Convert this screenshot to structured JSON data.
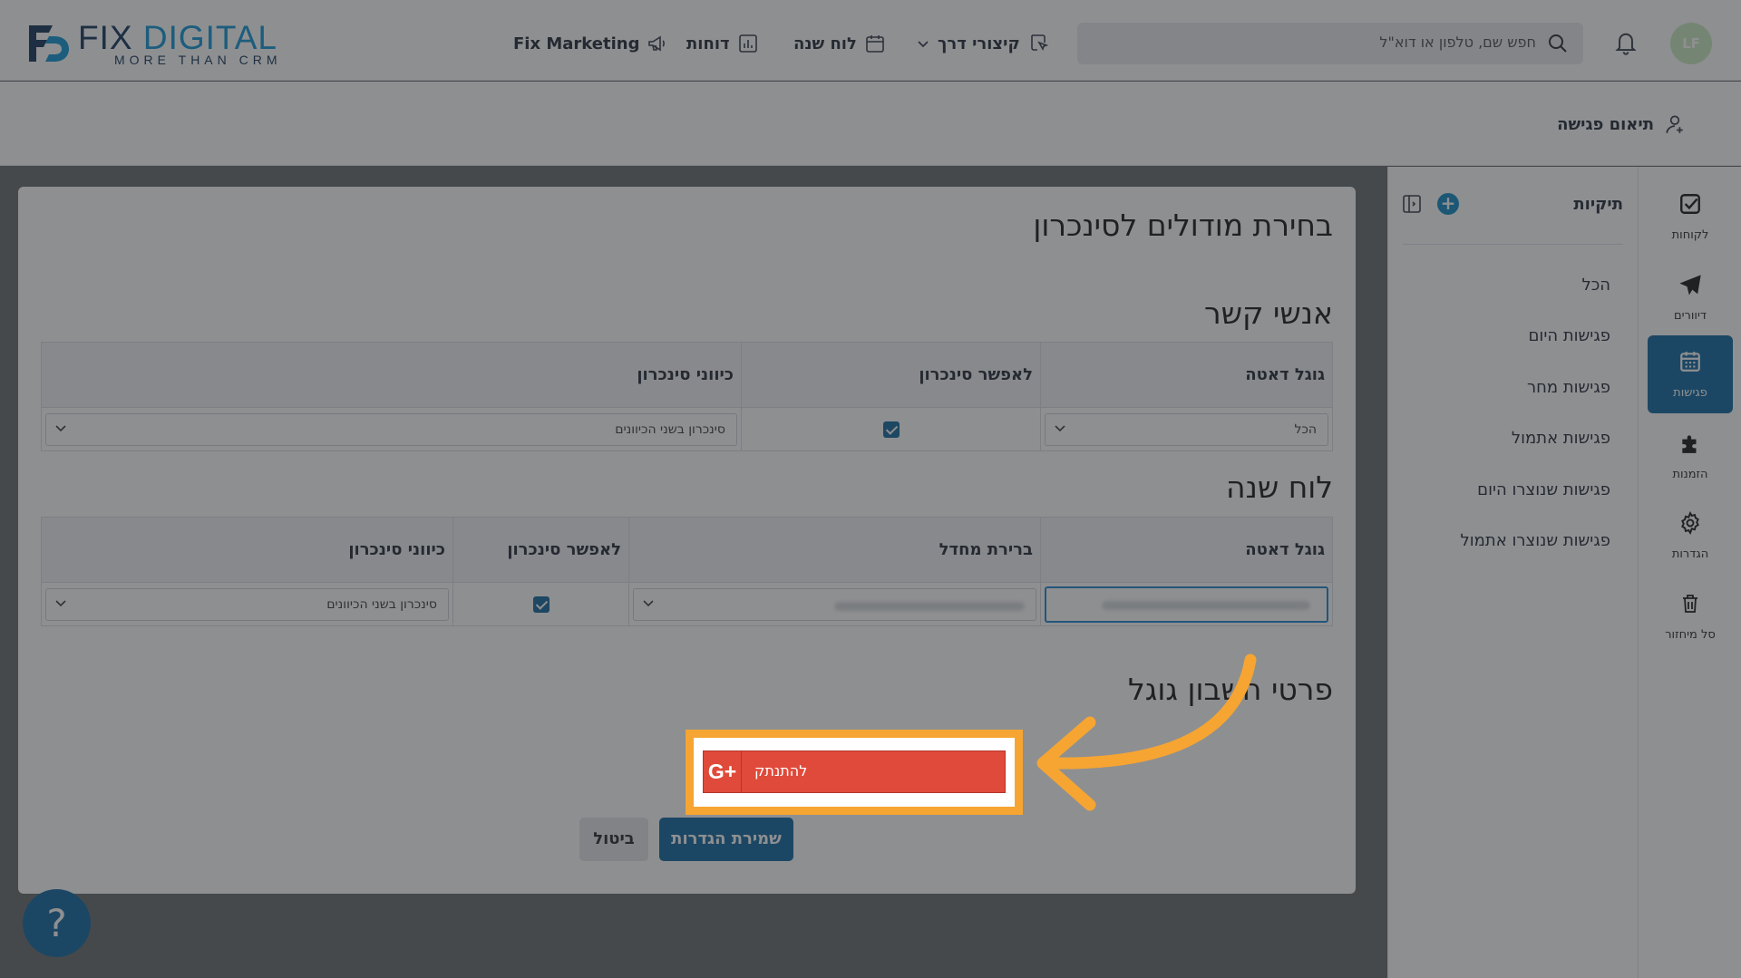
{
  "logo": {
    "word_fix": "FIX",
    "word_digital": "DIGITAL",
    "tagline": "MORE THAN CRM"
  },
  "topnav": {
    "marketing": "Fix Marketing",
    "reports": "דוחות",
    "calendar": "לוח שנה",
    "shortcuts": "קיצורי דרך"
  },
  "search": {
    "placeholder": "חפש שם, טלפון או דוא\"ל"
  },
  "user": {
    "initials": "LF"
  },
  "subbar": {
    "action_label": "תיאום פגישה"
  },
  "rail": {
    "customers": "לקוחות",
    "mailings": "דיוורים",
    "meetings": "פגישות",
    "orders": "הזמנות",
    "settings": "הגדרות",
    "trash": "סל מיחזור"
  },
  "folders": {
    "title": "תיקיות",
    "add": "+",
    "items": [
      "הכל",
      "פגישות היום",
      "פגישות מחר",
      "פגישות אתמול",
      "פגישות שנוצרו היום",
      "פגישות שנוצרו אתמול"
    ]
  },
  "main": {
    "title": "בחירת מודולים לסינכרון",
    "contacts": {
      "title": "אנשי קשר",
      "headers": {
        "google_data": "גוגל דאטה",
        "enable_sync": "לאפשר סינכרון",
        "sync_direction": "כיווני סינכרון"
      },
      "google_data_value": "הכל",
      "enable_sync_checked": true,
      "sync_direction_value": "סינכרון בשני הכיוונים"
    },
    "calendar": {
      "title": "לוח שנה",
      "headers": {
        "google_data": "גוגל דאטה",
        "default": "ברירת מחדל",
        "enable_sync": "לאפשר סינכרון",
        "sync_direction": "כיווני סינכרון"
      },
      "enable_sync_checked": true,
      "sync_direction_value": "סינכרון בשני הכיוונים"
    },
    "google_account": {
      "title": "פרטי חשבון גוגל",
      "disconnect_label": "להתנתק",
      "g_icon": "G+"
    },
    "buttons": {
      "save": "שמירת הגדרות",
      "cancel": "ביטול"
    }
  },
  "help": {
    "label": "?"
  },
  "colors": {
    "primary": "#1b6fa5",
    "google_red": "#e04a3a",
    "highlight": "#f6a532",
    "accent_blue": "#1a9bd7"
  }
}
